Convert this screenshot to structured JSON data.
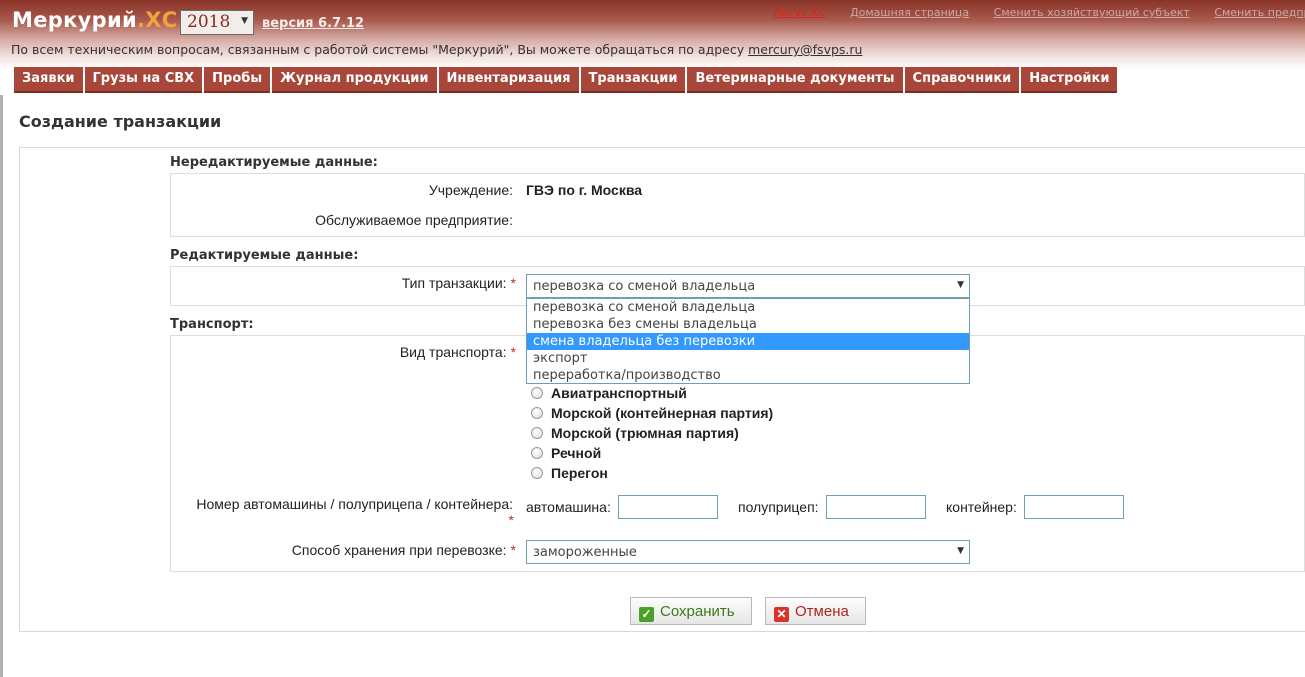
{
  "header": {
    "logo_main": "Меркурий",
    "logo_suffix": ".ХС",
    "year": "2018",
    "version": "версия 6.7.12",
    "links": [
      "Аргус.ХС",
      "Домашняя страница",
      "Сменить хозяйствующий субъект",
      "Сменить предпр"
    ],
    "notice_text": "По всем техническим вопросам, связанным с работой системы \"Меркурий\", Вы можете обращаться по адресу ",
    "notice_email": "mercury@fsvps.ru"
  },
  "nav": [
    "Заявки",
    "Грузы на СВХ",
    "Пробы",
    "Журнал продукции",
    "Инвентаризация",
    "Транзакции",
    "Ветеринарные документы",
    "Справочники",
    "Настройки"
  ],
  "page_title": "Создание транзакции",
  "non_editable": {
    "section_title": "Нередактируемые данные:",
    "institution_label": "Учреждение:",
    "institution_value": "ГВЭ по г. Москва",
    "enterprise_label": "Обслуживаемое предприятие:"
  },
  "editable": {
    "section_title": "Редактируемые данные:",
    "transaction_type_label": "Тип транзакции:",
    "transaction_type_value": "перевозка со сменой владельца",
    "transaction_type_options": [
      "перевозка со сменой владельца",
      "перевозка без смены владельца",
      "смена владельца без перевозки",
      "экспорт",
      "переработка/производство"
    ],
    "highlighted_option_index": 2
  },
  "transport": {
    "section_title": "Транспорт:",
    "type_label": "Вид транспорта:",
    "types": [
      "Авиатранспортный",
      "Морской (контейнерная партия)",
      "Морской (трюмная партия)",
      "Речной",
      "Перегон"
    ],
    "number_label": "Номер автомашины / полуприцепа / контейнера:",
    "car_label": "автомашина:",
    "trailer_label": "полуприцеп:",
    "container_label": "контейнер:",
    "storage_label": "Способ хранения при перевозке:",
    "storage_value": "замороженные"
  },
  "required_mark": "*",
  "buttons": {
    "save": "Сохранить",
    "cancel": "Отмена"
  },
  "colors": {
    "header_dark": "#8a3428",
    "nav_tab": "#a8463a",
    "logo_accent": "#f3a33b",
    "highlight": "#3399ff"
  }
}
